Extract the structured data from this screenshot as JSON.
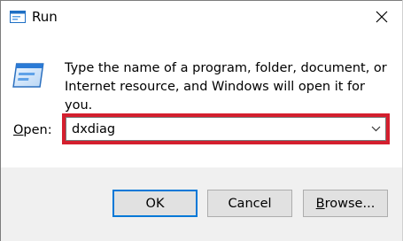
{
  "window": {
    "title": "Run",
    "app_icon": "run-icon",
    "close_icon": "close-icon"
  },
  "body": {
    "icon": "run-icon",
    "description": "Type the name of a program, folder, document, or Internet resource, and Windows will open it for you."
  },
  "open_field": {
    "label_accel": "O",
    "label_rest": "pen:",
    "value": "dxdiag",
    "dropdown_icon": "chevron-down-icon",
    "highlight_color": "#d41f2e"
  },
  "buttons": {
    "ok": "OK",
    "cancel": "Cancel",
    "browse_accel": "B",
    "browse_rest": "rowse..."
  },
  "colors": {
    "default_button_border": "#0078d7",
    "footer_bg": "#f0f0f0"
  }
}
